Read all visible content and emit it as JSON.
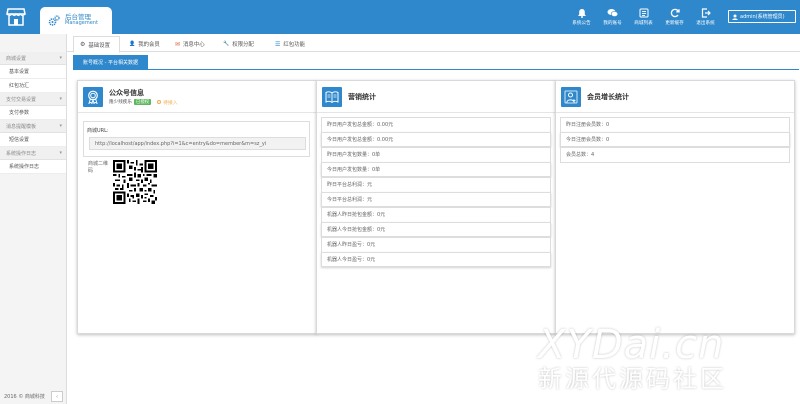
{
  "header": {
    "brand_title": "后台管理",
    "brand_sub": "Management",
    "nav": [
      {
        "label": "系统公告",
        "icon": "bell-icon"
      },
      {
        "label": "我的账号",
        "icon": "chat-icon"
      },
      {
        "label": "商城列表",
        "icon": "list-icon"
      },
      {
        "label": "更新缓存",
        "icon": "refresh-icon"
      },
      {
        "label": "退出系统",
        "icon": "logout-icon"
      }
    ],
    "user": "admin(系统管理员)"
  },
  "sidebar": {
    "groups": [
      {
        "label": "商城设置",
        "items": [
          "基本设置",
          "红包功汇"
        ]
      },
      {
        "label": "支付交易设置",
        "items": [
          "支付参数"
        ]
      },
      {
        "label": "消息提醒模板",
        "items": [
          "短信设置"
        ]
      },
      {
        "label": "系统操作日志",
        "items": [
          "系统操作日志"
        ]
      }
    ],
    "footer": "2016 © 商城科技",
    "collapse_icon": "‹"
  },
  "tabs": [
    {
      "label": "基础设置",
      "icon": "⚙",
      "color": "#555555"
    },
    {
      "label": "我的会员",
      "icon": "👤",
      "color": "#3c9a3c"
    },
    {
      "label": "消息中心",
      "icon": "✉",
      "color": "#e0623a"
    },
    {
      "label": "权限分配",
      "icon": "🔧",
      "color": "#2f88cc"
    },
    {
      "label": "红包功能",
      "icon": "☰",
      "color": "#2f88cc"
    }
  ],
  "sub_tab": "账号概况 - 平台相关数据",
  "info_panel": {
    "title": "公众号信息",
    "account": "隆少残疾乐",
    "auth_badge": "已授权",
    "pending": "待接入",
    "url_label": "商城URL:",
    "url_value": "http://localhost/app/index.php?i=1&c=entry&do=member&m=sz_yi",
    "qr_label": "商城二维码"
  },
  "marketing_panel": {
    "title": "营销统计",
    "rows": [
      "昨日用户发包总金额：0.00元",
      "今日用户发包总金额：0.00元",
      "昨日用户发包数量：0单",
      "今日用户发包数量：0单",
      "昨日平台总利润：元",
      "今日平台总利润：元",
      "机器人昨日抢包金额：0元",
      "机器人今日抢包金额：0元",
      "机器人昨日盈亏：0元",
      "机器人今日盈亏：0元"
    ]
  },
  "growth_panel": {
    "title": "会员增长统计",
    "rows": [
      "昨日注册会员数：0",
      "今日注册会员数：0",
      "会员总数：4"
    ]
  },
  "watermark": {
    "top": "XYDai.cn",
    "bottom": "新源代源码社区"
  },
  "colors": {
    "primary": "#2f88cc",
    "success": "#5cb85c",
    "warning": "#f0ad4e"
  }
}
